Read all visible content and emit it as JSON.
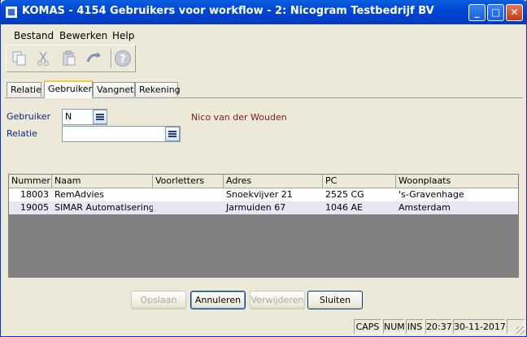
{
  "window": {
    "title": "KOMAS - 4154 Gebruikers voor workflow - 2: Nicogram Testbedrijf BV",
    "minimize_glyph": "_",
    "maximize_glyph": "□",
    "close_glyph": "✕"
  },
  "menu": [
    {
      "label": "Bestand"
    },
    {
      "label": "Bewerken"
    },
    {
      "label": "Help"
    }
  ],
  "toolbar": {
    "icons": [
      "copy-icon",
      "cut-icon",
      "paste-icon",
      "refresh-icon",
      "help-icon"
    ]
  },
  "tabs": [
    {
      "label": "Relatie",
      "active": false
    },
    {
      "label": "Gebruiker",
      "active": true
    },
    {
      "label": "Vangnet",
      "active": false
    },
    {
      "label": "Rekening",
      "active": false
    }
  ],
  "form": {
    "gebruiker_label": "Gebruiker",
    "gebruiker_value": "N",
    "gebruiker_name": "Nico van der Wouden",
    "relatie_label": "Relatie",
    "relatie_value": ""
  },
  "grid": {
    "columns": [
      "Nummer",
      "Naam",
      "Voorletters",
      "Adres",
      "PC",
      "Woonplaats"
    ],
    "rows": [
      {
        "nummer": "18003",
        "naam": "RemAdvies",
        "voorletters": "",
        "adres": "Snoekvijver 21",
        "pc": "2525 CG",
        "woonplaats": "'s-Gravenhage"
      },
      {
        "nummer": "19005",
        "naam": "SIMAR Automatisering B'",
        "voorletters": "",
        "adres": "Jarmuiden 67",
        "pc": "1046 AE",
        "woonplaats": "Amsterdam"
      }
    ]
  },
  "buttons": {
    "opslaan": "Opslaan",
    "annuleren": "Annuleren",
    "verwijderen": "Verwijderen",
    "sluiten": "Sluiten"
  },
  "status": {
    "caps": "CAPS",
    "num": "NUM",
    "ins": "INS",
    "time": "20:37",
    "date": "30-11-2017"
  }
}
